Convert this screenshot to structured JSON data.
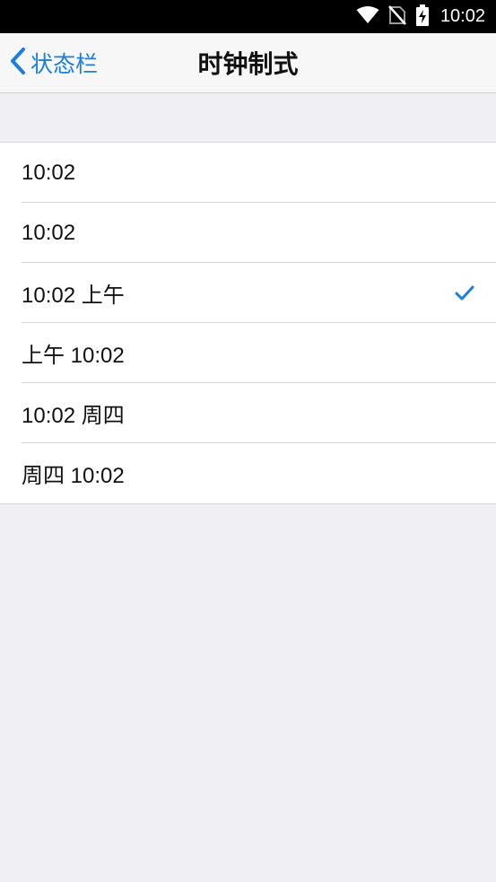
{
  "status_bar": {
    "time": "10:02",
    "icons": [
      "wifi-icon",
      "no-sim-icon",
      "battery-charging-icon"
    ]
  },
  "nav": {
    "back_label": "状态栏",
    "title": "时钟制式"
  },
  "options": [
    {
      "label": "10:02",
      "selected": false
    },
    {
      "label": "10:02",
      "selected": false
    },
    {
      "label": "10:02 上午",
      "selected": true
    },
    {
      "label": "上午 10:02",
      "selected": false
    },
    {
      "label": "10:02 周四",
      "selected": false
    },
    {
      "label": "周四 10:02",
      "selected": false
    }
  ],
  "colors": {
    "accent": "#1a7ee0",
    "background": "#efeff4",
    "status_bar": "#000000"
  }
}
